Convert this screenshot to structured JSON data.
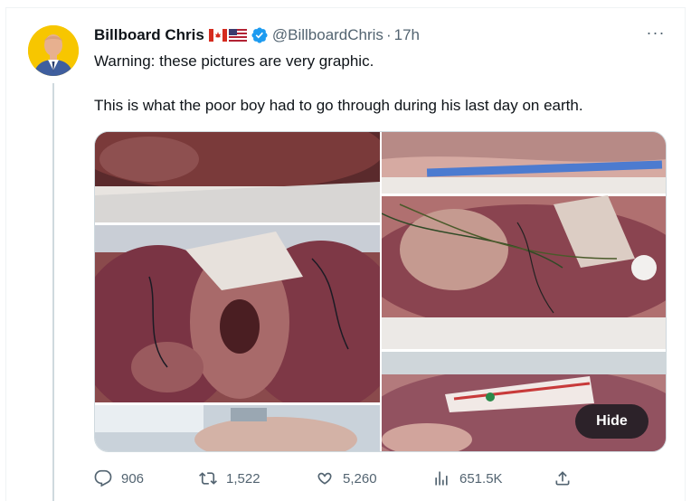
{
  "tweet": {
    "author_name": "Billboard Chris",
    "handle": "@BillboardChris",
    "separator": "·",
    "time": "17h",
    "flags": [
      "flag-canada-icon",
      "flag-usa-icon"
    ],
    "verified": true,
    "text_line1": "Warning: these pictures are very graphic.",
    "text_line2": "This is what the poor boy had to go through during his last day on earth.",
    "more_label": "···"
  },
  "media": {
    "photo_count": 2,
    "hide_label": "Hide"
  },
  "actions": {
    "replies": "906",
    "reposts": "1,522",
    "likes": "5,260",
    "views": "651.5K"
  },
  "colors": {
    "text": "#0f1419",
    "secondary": "#536471",
    "verified": "#1d9bf0",
    "border": "#eff3f4"
  }
}
